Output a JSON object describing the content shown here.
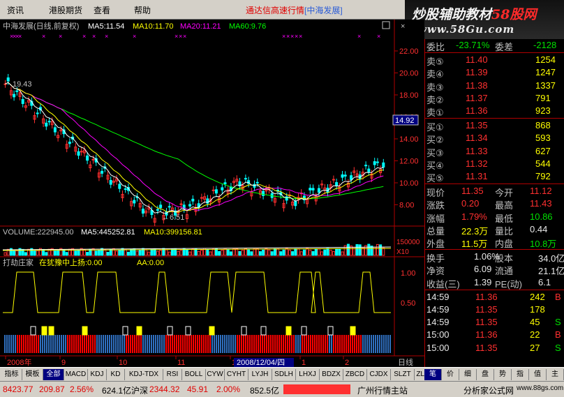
{
  "menu": {
    "items": [
      "资讯",
      "港股期货",
      "查看",
      "帮助"
    ],
    "ticker_prefix": "通达信高速行情",
    "ticker_stock": "[中海发展]"
  },
  "banner": {
    "title_a": "炒股辅助教材",
    "title_b": "58股网",
    "url": "www.58Gu.com"
  },
  "chart": {
    "header": {
      "stock": "中海发展(日线,前复权)",
      "ma5": "MA5:11.54",
      "ma10": "MA10:11.70",
      "ma20": "MA20:11.21",
      "ma60": "MA60:9.76"
    },
    "price_axis": [
      "22.00",
      "20.00",
      "18.00",
      "16.00",
      "14.00",
      "12.00",
      "10.00",
      "8.00"
    ],
    "current_price_tag": "14.92",
    "high_marker": "19.43",
    "low_marker": "←6.51",
    "volume": {
      "label": "VOLUME:222945.00",
      "ma5": "MA5:445252.81",
      "ma10": "MA10:399156.81",
      "axis_top": "150000",
      "unit": "X10"
    },
    "indicator": {
      "name": "打劫庄家",
      "line1": "在犹豫中上扬:0.00",
      "line2": "AA:0.00",
      "axis": [
        "1.00",
        "0.50"
      ]
    },
    "date_axis": [
      "2008年",
      "9",
      "10",
      "11",
      "12",
      "1",
      "2"
    ],
    "cursor_date": "2008/12/04/四",
    "period": "日线"
  },
  "colors": {
    "up": "#ff3030",
    "down": "#00ffff",
    "ma5": "#ffffff",
    "ma10": "#ffff00",
    "ma20": "#ff00ff",
    "ma60": "#00ff00"
  },
  "quote": {
    "ratio": {
      "label": "委比",
      "value": "-23.71%",
      "diff_label": "委差",
      "diff": "-2128"
    },
    "sells": [
      {
        "label": "卖⑤",
        "price": "11.40",
        "vol": "1254"
      },
      {
        "label": "卖④",
        "price": "11.39",
        "vol": "1247"
      },
      {
        "label": "卖③",
        "price": "11.38",
        "vol": "1337"
      },
      {
        "label": "卖②",
        "price": "11.37",
        "vol": "791"
      },
      {
        "label": "卖①",
        "price": "11.36",
        "vol": "923"
      }
    ],
    "buys": [
      {
        "label": "买①",
        "price": "11.35",
        "vol": "868"
      },
      {
        "label": "买②",
        "price": "11.34",
        "vol": "593"
      },
      {
        "label": "买③",
        "price": "11.33",
        "vol": "627"
      },
      {
        "label": "买④",
        "price": "11.32",
        "vol": "544"
      },
      {
        "label": "买⑤",
        "price": "11.31",
        "vol": "792"
      }
    ],
    "stats": [
      {
        "l1": "现价",
        "v1": "11.35",
        "l2": "今开",
        "v2": "11.12"
      },
      {
        "l1": "涨跌",
        "v1": "0.20",
        "l2": "最高",
        "v2": "11.43"
      },
      {
        "l1": "涨幅",
        "v1": "1.79%",
        "l2": "最低",
        "v2": "10.86"
      },
      {
        "l1": "总量",
        "v1": "22.3万",
        "l2": "量比",
        "v2": "0.44"
      },
      {
        "l1": "外盘",
        "v1": "11.5万",
        "l2": "内盘",
        "v2": "10.8万"
      }
    ],
    "stats2": [
      {
        "l1": "换手",
        "v1": "1.06%",
        "l2": "股本",
        "v2": "34.0亿"
      },
      {
        "l1": "净资",
        "v1": "6.09",
        "l2": "流通",
        "v2": "21.1亿"
      },
      {
        "l1": "收益(三)",
        "v1": "1.39",
        "l2": "PE(动)",
        "v2": "6.1"
      }
    ],
    "ticks": [
      {
        "time": "14:59",
        "price": "11.36",
        "vol": "242",
        "flag": "B"
      },
      {
        "time": "14:59",
        "price": "11.35",
        "vol": "178",
        "flag": ""
      },
      {
        "time": "14:59",
        "price": "11.35",
        "vol": "45",
        "flag": "S"
      },
      {
        "time": "15:00",
        "price": "11.36",
        "vol": "22",
        "flag": "B"
      },
      {
        "time": "15:00",
        "price": "11.35",
        "vol": "27",
        "flag": "S"
      }
    ]
  },
  "tabs": [
    "指标",
    "模板",
    "全部",
    "MACD",
    "KDJ",
    "KD",
    "KDJ-TDX",
    "RSI",
    "BOLL",
    "CYW",
    "CYHT",
    "LYJH",
    "SDLH",
    "LHXJ",
    "BDZX",
    "ZBCD",
    "CJDX",
    "SLZT",
    "ZLMM"
  ],
  "right_tabs": [
    "笔",
    "价",
    "细",
    "盘",
    "势",
    "指",
    "值",
    "主"
  ],
  "status": {
    "sh_index": "8423.77",
    "sh_change": "209.87",
    "sh_pct": "2.56%",
    "sh_amount": "624.1亿",
    "sz_label": "沪深",
    "sz_index": "2344.32",
    "sz_change": "45.91",
    "sz_pct": "2.00%",
    "sz_amount": "852.5亿",
    "server": "广州行情主站",
    "brand": "分析家公式网",
    "site": "www.88gs.com"
  }
}
